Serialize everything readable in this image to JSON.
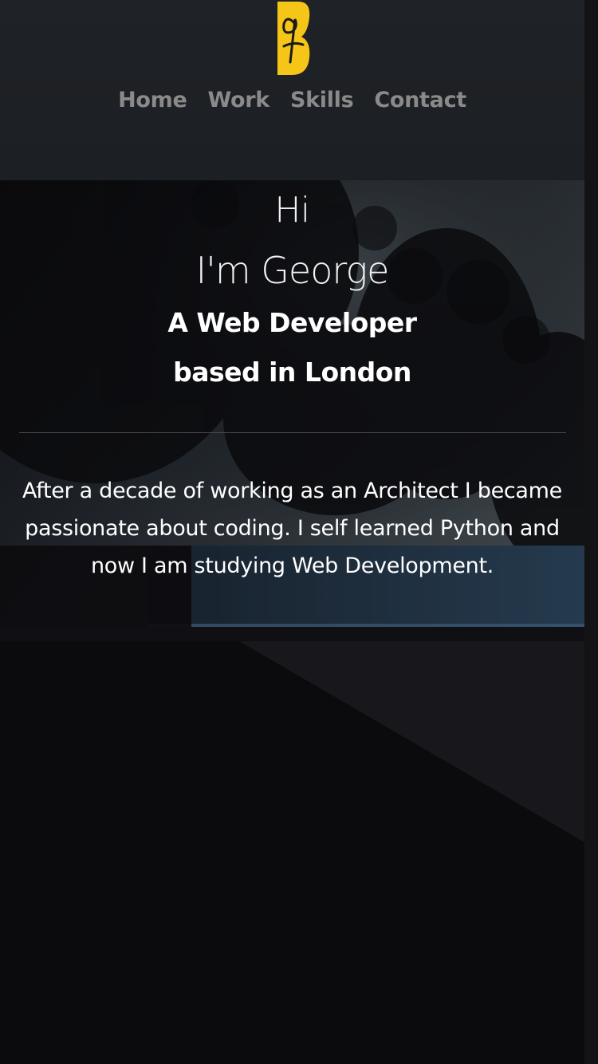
{
  "header": {
    "logo_alt": "George logo",
    "nav": [
      {
        "label": "Home"
      },
      {
        "label": "Work"
      },
      {
        "label": "Skills"
      },
      {
        "label": "Contact"
      }
    ]
  },
  "hero": {
    "greeting": "Hi",
    "name": "I'm George",
    "role_line1": "A Web Developer",
    "role_line2": "based in London",
    "bio": "After a decade of working as an Architect I became passionate about coding. I self learned Python and now I am studying Web Development."
  },
  "colors": {
    "accent": "#f5c518",
    "header_bg": "#1f2226",
    "nav_text": "#8a8a8a",
    "hero_text": "#ffffff"
  }
}
